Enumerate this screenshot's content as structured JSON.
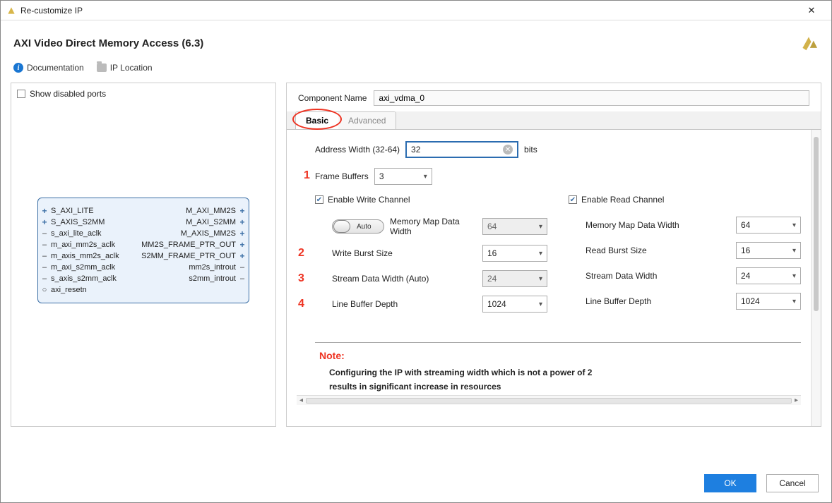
{
  "window": {
    "title": "Re-customize IP"
  },
  "header": {
    "title": "AXI Video Direct Memory Access (6.3)"
  },
  "infobar": {
    "documentation": "Documentation",
    "ip_location": "IP Location"
  },
  "left": {
    "show_disabled_label": "Show disabled ports",
    "ports_left": [
      "S_AXI_LITE",
      "S_AXIS_S2MM",
      "s_axi_lite_aclk",
      "m_axi_mm2s_aclk",
      "m_axis_mm2s_aclk",
      "m_axi_s2mm_aclk",
      "s_axis_s2mm_aclk",
      "axi_resetn"
    ],
    "ports_right": [
      "M_AXI_MM2S",
      "M_AXI_S2MM",
      "M_AXIS_MM2S",
      "MM2S_FRAME_PTR_OUT",
      "S2MM_FRAME_PTR_OUT",
      "mm2s_introut",
      "s2mm_introut"
    ]
  },
  "component": {
    "label": "Component Name",
    "value": "axi_vdma_0"
  },
  "tabs": {
    "basic": "Basic",
    "advanced": "Advanced"
  },
  "annotations": {
    "n1": "1",
    "n2": "2",
    "n3": "3",
    "n4": "4"
  },
  "form": {
    "addr_label": "Address Width (32-64)",
    "addr_value": "32",
    "addr_unit": "bits",
    "fb_label": "Frame Buffers",
    "fb_value": "3",
    "auto_label": "Auto",
    "write": {
      "enable_label": "Enable Write Channel",
      "mm_label": "Memory Map Data Width",
      "mm_value": "64",
      "burst_label": "Write Burst Size",
      "burst_value": "16",
      "stream_label": "Stream Data Width (Auto)",
      "stream_value": "24",
      "lbuf_label": "Line Buffer Depth",
      "lbuf_value": "1024"
    },
    "read": {
      "enable_label": "Enable Read Channel",
      "mm_label": "Memory Map Data Width",
      "mm_value": "64",
      "burst_label": "Read Burst Size",
      "burst_value": "16",
      "stream_label": "Stream Data Width",
      "stream_value": "24",
      "lbuf_label": "Line Buffer Depth",
      "lbuf_value": "1024"
    },
    "note_title": "Note:",
    "note_body1": "Configuring the IP with streaming width which is not a power of 2",
    "note_body2": "results in significant increase in resources"
  },
  "buttons": {
    "ok": "OK",
    "cancel": "Cancel"
  }
}
